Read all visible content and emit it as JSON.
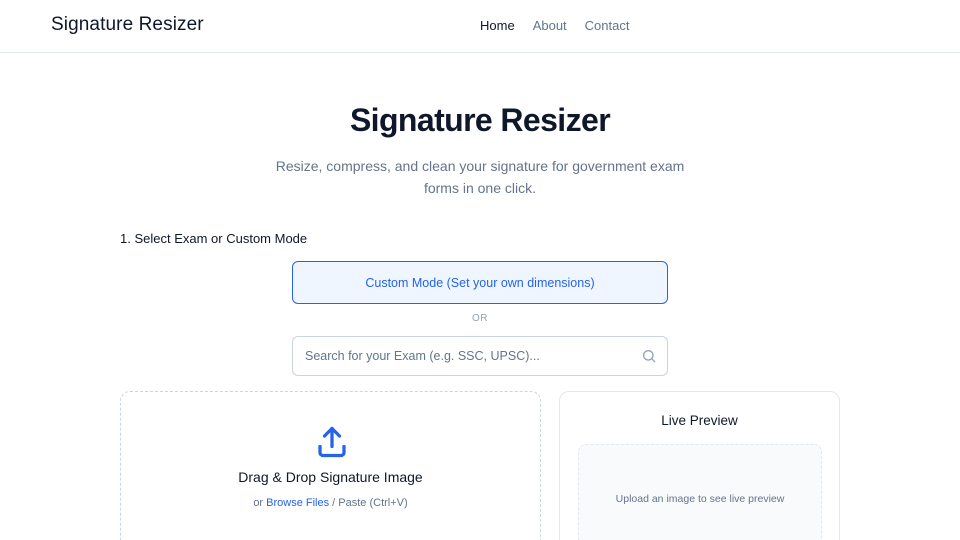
{
  "header": {
    "brand": "Signature Resizer",
    "nav": [
      {
        "label": "Home",
        "active": true
      },
      {
        "label": "About",
        "active": false
      },
      {
        "label": "Contact",
        "active": false
      }
    ]
  },
  "hero": {
    "title": "Signature Resizer",
    "subtitle": "Resize, compress, and clean your signature for government exam forms in one click."
  },
  "exam_select": {
    "step_label": "1. Select Exam or Custom Mode",
    "custom_mode_label": "Custom Mode (Set your own dimensions)",
    "or_label": "OR",
    "search_placeholder": "Search for your Exam (e.g. SSC, UPSC)...",
    "search_value": "",
    "search_icon": "search-icon"
  },
  "upload": {
    "icon": "upload-icon",
    "title": "Drag & Drop Signature Image",
    "hint_prefix": "or ",
    "browse_label": "Browse Files",
    "hint_suffix": " / Paste (Ctrl+V)"
  },
  "preview": {
    "title": "Live Preview",
    "empty_text": "Upload an image to see live preview"
  },
  "colors": {
    "accent": "#2563eb",
    "accent_bg": "#eff6ff",
    "text": "#0f172a",
    "muted": "#64748b",
    "border": "#e2e8f0"
  }
}
